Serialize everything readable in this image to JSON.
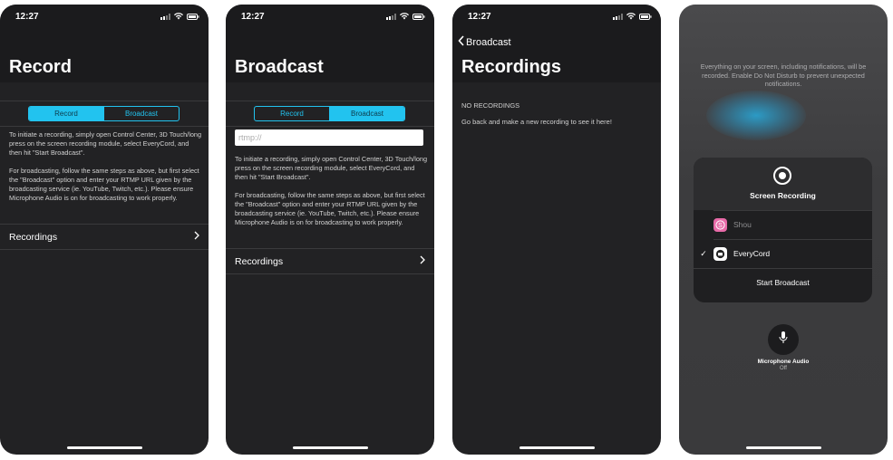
{
  "status": {
    "time": "12:27"
  },
  "screen1": {
    "title": "Record",
    "segments": [
      "Record",
      "Broadcast"
    ],
    "para1": "To initiate a recording, simply open Control Center, 3D Touch/long press on the screen recording module, select EveryCord, and then hit \"Start Broadcast\".",
    "para2": "For broadcasting, follow the same steps as above, but first select the \"Broadcast\" option and enter your RTMP URL given by the broadcasting service (ie. YouTube, Twitch, etc.). Please ensure Microphone Audio is on for broadcasting to work properly.",
    "recordings_label": "Recordings"
  },
  "screen2": {
    "title": "Broadcast",
    "segments": [
      "Record",
      "Broadcast"
    ],
    "rtmp_placeholder": "rtmp://",
    "para1": "To initiate a recording, simply open Control Center, 3D Touch/long press on the screen recording module, select EveryCord, and then hit \"Start Broadcast\".",
    "para2": "For broadcasting, follow the same steps as above, but first select the \"Broadcast\" option and enter your RTMP URL given by the broadcasting service (ie. YouTube, Twitch, etc.). Please ensure Microphone Audio is on for broadcasting to work properly.",
    "recordings_label": "Recordings"
  },
  "screen3": {
    "back_label": "Broadcast",
    "title": "Recordings",
    "empty_heading": "NO RECORDINGS",
    "empty_text": "Go back and make a new recording to see it here!"
  },
  "screen4": {
    "notice": "Everything on your screen, including notifications, will be recorded. Enable Do Not Disturb to prevent unexpected notifications.",
    "card_title": "Screen Recording",
    "apps": [
      {
        "label": "Shou",
        "selected": false,
        "icon": "shou-app-icon"
      },
      {
        "label": "EveryCord",
        "selected": true,
        "icon": "everycord-app-icon"
      }
    ],
    "checkmark": "✓",
    "start_label": "Start Broadcast",
    "mic_label": "Microphone Audio",
    "mic_state": "Off"
  },
  "colors": {
    "accent": "#22c3ef",
    "background": "#222224",
    "navbar": "#1b1b1d"
  }
}
